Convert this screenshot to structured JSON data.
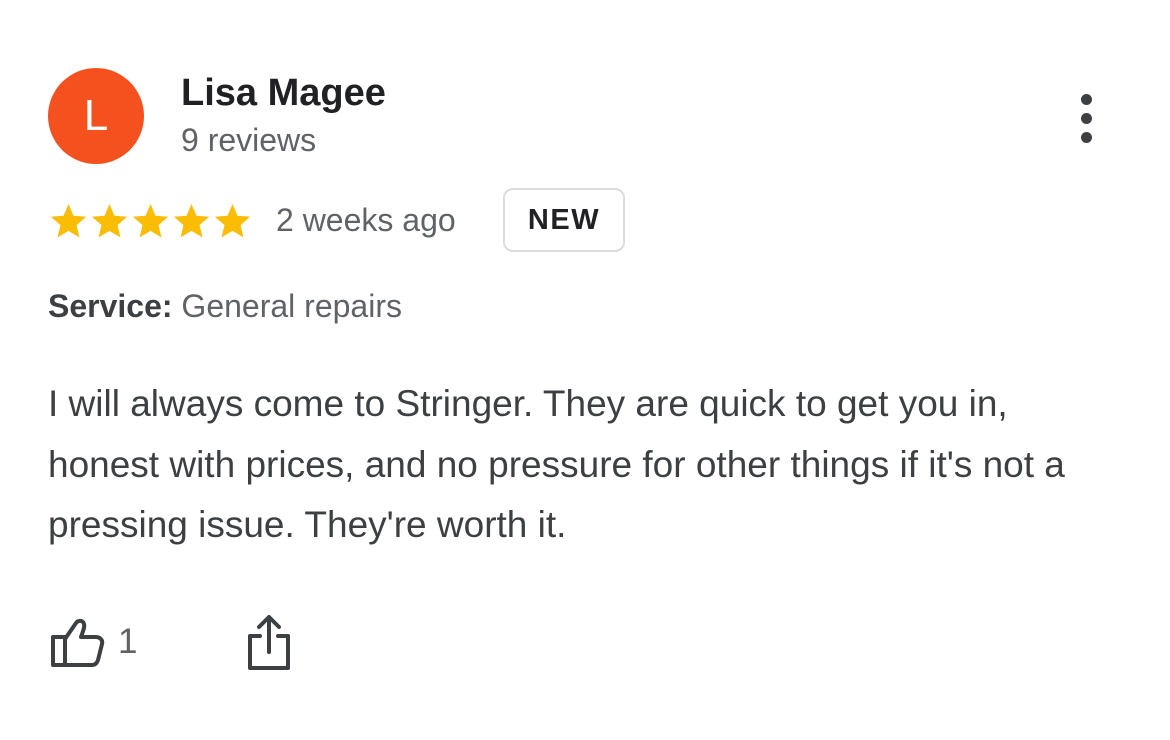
{
  "author": {
    "initial": "L",
    "name": "Lisa Magee",
    "reviews_text": "9 reviews",
    "avatar_color": "#f4511e"
  },
  "rating": {
    "stars": 5,
    "max_stars": 5,
    "star_color": "#fbbc04"
  },
  "date": "2 weeks ago",
  "badge": "NEW",
  "service": {
    "label": "Service:",
    "value": "General repairs"
  },
  "review_text": "I will always come to Stringer. They are quick to get you in, honest with prices, and no pressure for other things if it's not a pressing issue. They're worth it.",
  "actions": {
    "like_count": "1",
    "like_icon": "thumbs-up-icon",
    "share_icon": "share-icon",
    "more_icon": "more-vertical-icon"
  }
}
